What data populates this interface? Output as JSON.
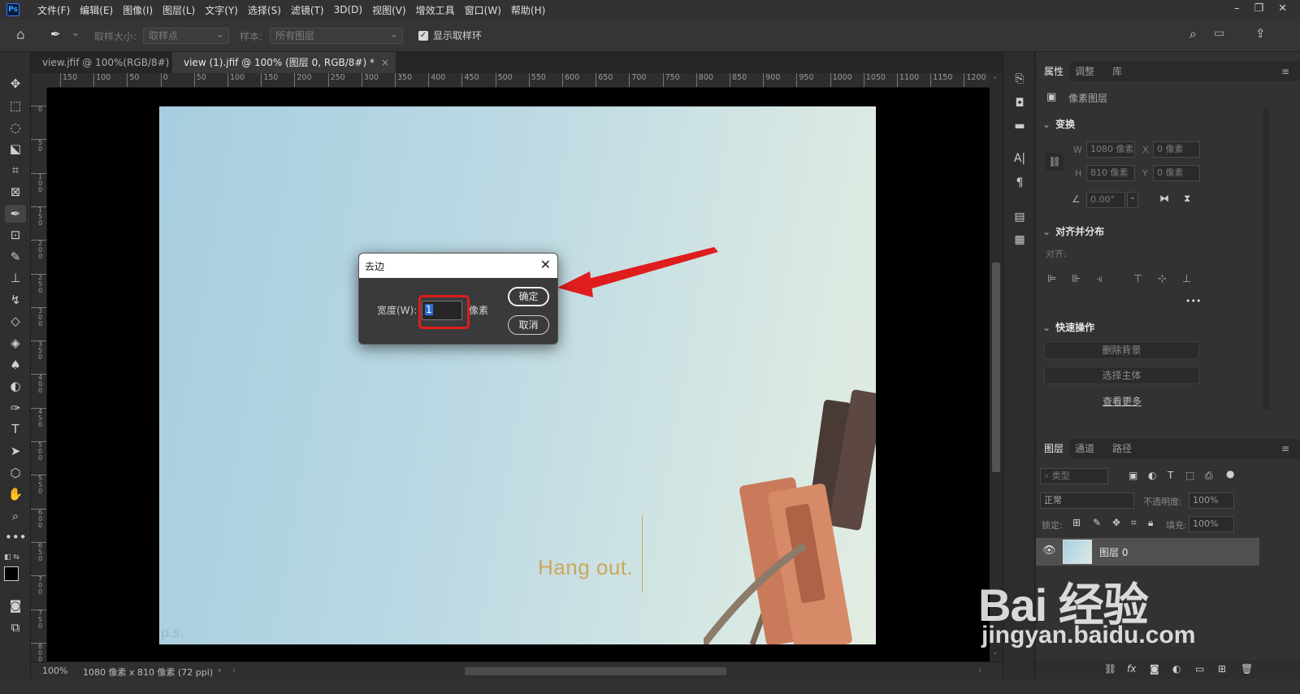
{
  "app": {
    "logo": "Ps"
  },
  "menu": [
    "文件(F)",
    "编辑(E)",
    "图像(I)",
    "图层(L)",
    "文字(Y)",
    "选择(S)",
    "滤镜(T)",
    "3D(D)",
    "视图(V)",
    "增效工具",
    "窗口(W)",
    "帮助(H)"
  ],
  "options": {
    "sample_size_label": "取样大小:",
    "sample_size_value": "取样点",
    "sample_label": "样本:",
    "sample_value": "所有图层",
    "show_ring_label": "显示取样环"
  },
  "tabs": [
    {
      "label": "view.jfif @ 100%(RGB/8#)",
      "active": false
    },
    {
      "label": "view (1).jfif @ 100% (图层 0, RGB/8#) *",
      "active": true
    }
  ],
  "ruler_h": [
    "150",
    "100",
    "50",
    "0",
    "50",
    "100",
    "150",
    "200",
    "250",
    "300",
    "350",
    "400",
    "450",
    "500",
    "550",
    "600",
    "650",
    "700",
    "750",
    "800",
    "850",
    "900",
    "950",
    "1000",
    "1050",
    "1100",
    "1150",
    "1200"
  ],
  "ruler_v": [
    "0",
    "5 0",
    "1 0 0",
    "1 5 0",
    "2 0 0",
    "2 5 0",
    "3 0 0",
    "3 5 0",
    "4 0 0",
    "4 5 0",
    "5 0 0",
    "5 5 0",
    "6 0 0",
    "6 5 0",
    "7 0 0",
    "7 5 0",
    "8 0 0"
  ],
  "canvas": {
    "text": "Hang out.",
    "mark": "p.s."
  },
  "status": {
    "zoom": "100%",
    "info": "1080 像素 x 810 像素 (72 ppi)",
    "arrow": "›"
  },
  "dialog": {
    "title": "去边",
    "width_label": "宽度(W):",
    "width_value": "1",
    "unit": "像素",
    "ok": "确定",
    "cancel": "取消"
  },
  "props_panel": {
    "tabs": [
      "属性",
      "调整",
      "库"
    ],
    "layer_type": "像素图层",
    "transform_title": "变换",
    "w_label": "W",
    "w_value": "1080 像素",
    "x_label": "X",
    "x_value": "0 像素",
    "h_label": "H",
    "h_value": "810 像素",
    "y_label": "Y",
    "y_value": "0 像素",
    "angle": "0.00°",
    "align_title": "对齐并分布",
    "align_label": "对齐:",
    "more": "•••",
    "quick_title": "快速操作",
    "remove_bg": "删除背景",
    "select_subject": "选择主体",
    "see_more": "查看更多"
  },
  "layers_panel": {
    "tabs": [
      "图层",
      "通道",
      "路径"
    ],
    "filter_placeholder": "类型",
    "blend_mode": "正常",
    "opacity_label": "不透明度:",
    "opacity_value": "100%",
    "lock_label": "锁定:",
    "fill_label": "填充:",
    "fill_value": "100%",
    "layer_name": "图层 0"
  },
  "watermark": {
    "main": "Bai 经验",
    "sub": "jingyan.baidu.com"
  },
  "colors": {
    "accent_red": "#e01d1d",
    "selection_blue": "#2d6fd0"
  }
}
